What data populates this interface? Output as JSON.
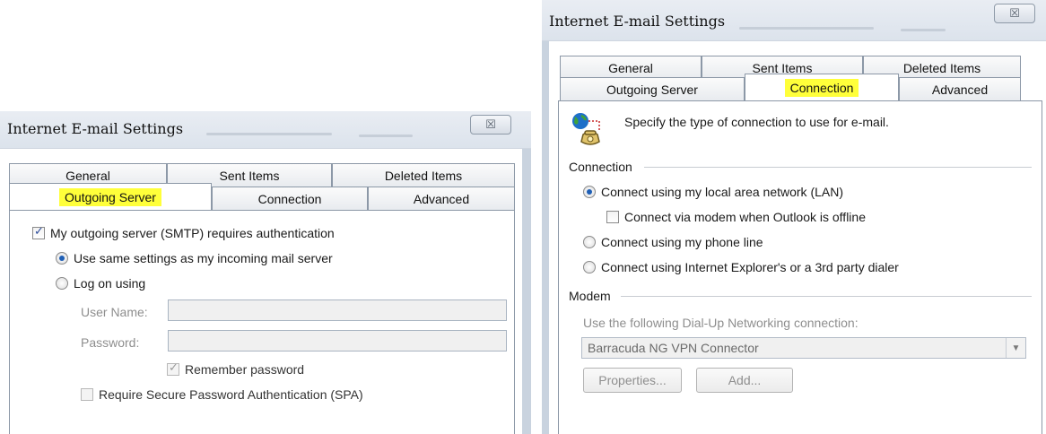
{
  "left_dialog": {
    "title": "Internet E-mail Settings",
    "close_glyph": "☒",
    "tabs_row1": [
      "General",
      "Sent Items",
      "Deleted Items"
    ],
    "tabs_row2": [
      "Outgoing Server",
      "Connection",
      "Advanced"
    ],
    "active_tab": "Outgoing Server",
    "smtp_auth_label": "My outgoing server (SMTP) requires authentication",
    "smtp_auth_checked": true,
    "same_settings_label": "Use same settings as my incoming mail server",
    "log_on_label": "Log on using",
    "username_label": "User Name:",
    "username_value": "",
    "password_label": "Password:",
    "password_value": "",
    "remember_label": "Remember password",
    "spa_label": "Require Secure Password Authentication (SPA)"
  },
  "right_dialog": {
    "title": "Internet E-mail Settings",
    "tabs_row1": [
      "General",
      "Sent Items",
      "Deleted Items"
    ],
    "tabs_row2": [
      "Outgoing Server",
      "Connection",
      "Advanced"
    ],
    "active_tab": "Connection",
    "intro_text": "Specify the type of connection to use for e-mail.",
    "connection_group": "Connection",
    "lan_label": "Connect using my local area network (LAN)",
    "modem_offline_label": "Connect via modem when Outlook is offline",
    "phone_label": "Connect using my phone line",
    "ie_label": "Connect using Internet Explorer's or a 3rd party dialer",
    "modem_group": "Modem",
    "dialup_label": "Use the following Dial-Up Networking connection:",
    "dialup_value": "Barracuda NG VPN Connector",
    "properties_label": "Properties...",
    "add_label": "Add..."
  },
  "colors": {
    "highlight": "#ffff3a",
    "radio_selected": "#1f5fb5",
    "disabled_text": "#8e8e8e"
  },
  "icons": [
    "close-icon",
    "globe-phone-icon",
    "dropdown-arrow-icon"
  ]
}
